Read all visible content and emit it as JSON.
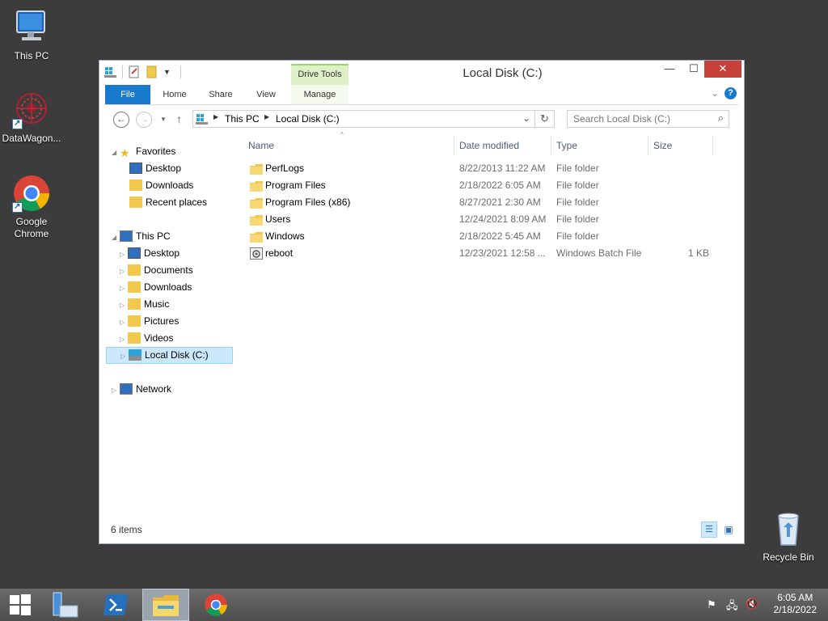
{
  "desktop": {
    "icons": [
      {
        "label": "This PC"
      },
      {
        "label": "DataWagon..."
      },
      {
        "label": "Google Chrome"
      },
      {
        "label": "Recycle Bin"
      }
    ]
  },
  "window": {
    "title": "Local Disk (C:)",
    "controls": {
      "minimize": "—",
      "maximize": "☐",
      "close": "✕"
    },
    "context_tab_group": "Drive Tools",
    "ribbon_tabs": [
      "File",
      "Home",
      "Share",
      "View",
      "Manage"
    ],
    "address": {
      "crumbs": [
        "This PC",
        "Local Disk (C:)"
      ]
    },
    "search": {
      "placeholder": "Search Local Disk (C:)"
    },
    "nav": {
      "favorites_label": "Favorites",
      "favorites": [
        "Desktop",
        "Downloads",
        "Recent places"
      ],
      "thispc_label": "This PC",
      "thispc_items": [
        "Desktop",
        "Documents",
        "Downloads",
        "Music",
        "Pictures",
        "Videos",
        "Local Disk (C:)"
      ],
      "network_label": "Network"
    },
    "columns": {
      "name": "Name",
      "date": "Date modified",
      "type": "Type",
      "size": "Size"
    },
    "files": [
      {
        "name": "PerfLogs",
        "date": "8/22/2013 11:22 AM",
        "type": "File folder",
        "size": "",
        "icon": "folder-icon"
      },
      {
        "name": "Program Files",
        "date": "2/18/2022 6:05 AM",
        "type": "File folder",
        "size": "",
        "icon": "folder-icon"
      },
      {
        "name": "Program Files (x86)",
        "date": "8/27/2021 2:30 AM",
        "type": "File folder",
        "size": "",
        "icon": "folder-icon"
      },
      {
        "name": "Users",
        "date": "12/24/2021 8:09 AM",
        "type": "File folder",
        "size": "",
        "icon": "folder-icon"
      },
      {
        "name": "Windows",
        "date": "2/18/2022 5:45 AM",
        "type": "File folder",
        "size": "",
        "icon": "folder-icon"
      },
      {
        "name": "reboot",
        "date": "12/23/2021 12:58 ...",
        "type": "Windows Batch File",
        "size": "1 KB",
        "icon": "batch-file-icon"
      }
    ],
    "status": {
      "item_count": "6 items"
    }
  },
  "taskbar": {
    "clock_time": "6:05 AM",
    "clock_date": "2/18/2022"
  },
  "colors": {
    "desktop": "#3c3c3c",
    "file_tab": "#1979ca",
    "context_tab": "#dff0c8",
    "close_button": "#c7403a",
    "selection": "#cce8ff"
  }
}
